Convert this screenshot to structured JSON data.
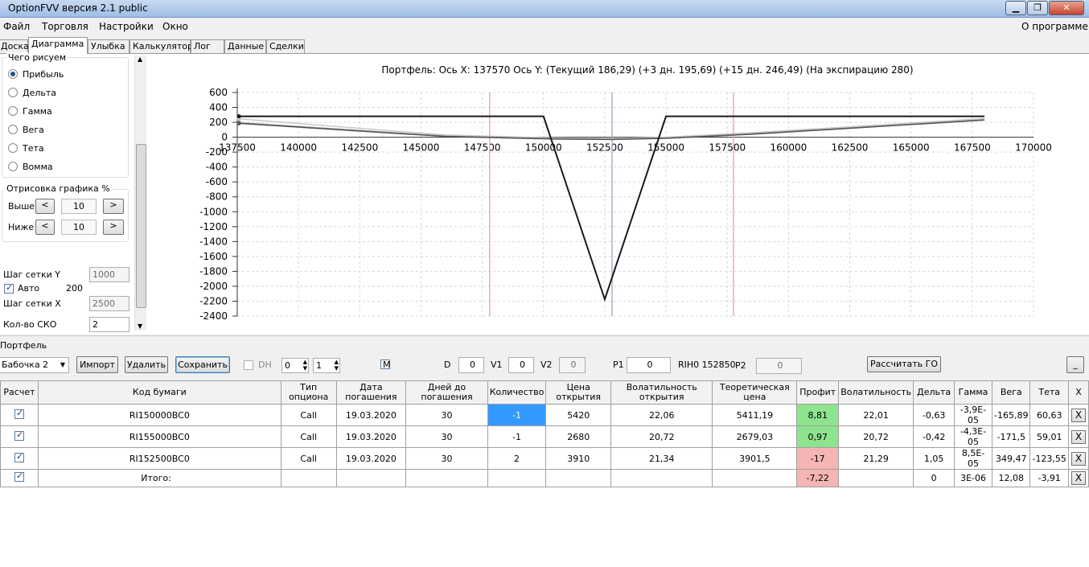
{
  "window": {
    "title": "OptionFVV версия 2.1 public",
    "minimize": "▁",
    "maximize": "❐",
    "close": "✕"
  },
  "menu": {
    "file": "Файл",
    "trading": "Торговля",
    "settings": "Настройки",
    "window": "Окно",
    "about": "О программе"
  },
  "tabs": [
    "Доска",
    "Диаграмма",
    "Улыбка",
    "Калькулятор",
    "Лог",
    "Данные",
    "Сделки"
  ],
  "left_panel": {
    "draw_group_title": "Чего рисуем",
    "radios": [
      "Прибыль",
      "Дельта",
      "Гамма",
      "Вега",
      "Тета",
      "Вомма"
    ],
    "selected_radio": "Прибыль",
    "render_group_title": "Отрисовка графика %",
    "above_label": "Выше",
    "above_value": "10",
    "below_label": "Ниже",
    "below_value": "10",
    "dec": "<",
    "inc": ">",
    "grid_y_label": "Шаг сетки Y",
    "grid_y_value": "1000",
    "auto_label": "Авто",
    "auto_value": "200",
    "grid_x_label": "Шаг сетки X",
    "grid_x_value": "2500",
    "sko_label": "Кол-во СКО",
    "sko_value": "2"
  },
  "chart_data": {
    "type": "line",
    "title": "Портфель: Ось X: 137570 Ось Y:  (Текущий 186,29)  (+3 дн. 195,69)  (+15 дн. 246,49)  (На экспирацию 280)",
    "xlim": [
      137500,
      170000
    ],
    "ylim": [
      -2400,
      600
    ],
    "xticks": [
      137500,
      140000,
      142500,
      145000,
      147500,
      150000,
      152500,
      155000,
      157500,
      160000,
      162500,
      165000,
      167500,
      170000
    ],
    "yticks": [
      600,
      400,
      200,
      0,
      -200,
      -400,
      -600,
      -800,
      -1000,
      -1200,
      -1400,
      -1600,
      -1800,
      -2000,
      -2200,
      -2400
    ],
    "grid": true,
    "vlines": [
      {
        "x": 147800,
        "color": "#f4a6b8"
      },
      {
        "x": 152800,
        "color": "#a8b4c8"
      },
      {
        "x": 157750,
        "color": "#f4a6b8"
      }
    ],
    "series": [
      {
        "color": "#1a1a1a",
        "width": 2,
        "x": [
          137570,
          150000,
          152500,
          155000,
          168000
        ],
        "y": [
          280,
          280,
          -2175,
          280,
          280
        ]
      },
      {
        "color": "#555555",
        "width": 1.5,
        "x": [
          137570,
          146000,
          150500,
          152800,
          155000,
          158500,
          168000
        ],
        "y": [
          186,
          10,
          -25,
          -30,
          -15,
          40,
          230
        ]
      },
      {
        "color": "#9a9a9a",
        "width": 1.5,
        "x": [
          137570,
          146000,
          150500,
          152800,
          155000,
          158500,
          168000
        ],
        "y": [
          196,
          15,
          -20,
          -28,
          -10,
          45,
          235
        ]
      },
      {
        "color": "#c8c8c8",
        "width": 1.5,
        "x": [
          137570,
          146000,
          150500,
          152800,
          155000,
          158500,
          168000
        ],
        "y": [
          246,
          30,
          -10,
          -20,
          0,
          60,
          250
        ]
      }
    ]
  },
  "portfolio_label": "Портфель",
  "toolbar": {
    "portfolio_select": "Бабочка 2",
    "import": "Импорт",
    "delete": "Удалить",
    "save": "Сохранить",
    "dh_label": "DH",
    "dh_spin1": "0",
    "dh_spin2": "1",
    "m_label": "M",
    "d_label": "D",
    "d_value": "0",
    "v1_label": "V1",
    "v1_value": "0",
    "v2_label": "V2",
    "v2_value": "0",
    "p1_label": "P1",
    "p1_value": "0",
    "rih_label": "RIH0 152850",
    "p2_label": "P2",
    "p2_value": "0",
    "calc_go": "Рассчитать ГО",
    "collapse": "_"
  },
  "grid": {
    "headers": [
      "Расчет",
      "Код бумаги",
      "Тип опциона",
      "Дата погашения",
      "Дней до погашения",
      "Количество",
      "Цена открытия",
      "Волатильность открытия",
      "Теоретическая цена",
      "Профит",
      "Волатильность",
      "Дельта",
      "Гамма",
      "Вега",
      "Тета",
      "X"
    ],
    "rows": [
      [
        "RI150000BC0",
        "Call",
        "19.03.2020",
        "30",
        "-1",
        "5420",
        "22,06",
        "5411,19",
        "8,81",
        "22,01",
        "-0,63",
        "-3,9E-05",
        "-165,89",
        "60,63"
      ],
      [
        "RI155000BC0",
        "Call",
        "19.03.2020",
        "30",
        "-1",
        "2680",
        "20,72",
        "2679,03",
        "0,97",
        "20,72",
        "-0,42",
        "-4,3E-05",
        "-171,5",
        "59,01"
      ],
      [
        "RI152500BC0",
        "Call",
        "19.03.2020",
        "30",
        "2",
        "3910",
        "21,34",
        "3901,5",
        "-17",
        "21,29",
        "1,05",
        "8,5E-05",
        "349,47",
        "-123,55"
      ]
    ],
    "total": {
      "label": "Итого:",
      "profit": "-7,22",
      "delta": "0",
      "gamma": "3E-06",
      "vega": "12,08",
      "theta": "-3,91"
    },
    "profit_colors": {
      "positive": "#8ee38e",
      "negative": "#f5b5b5"
    },
    "selected_cell_color": "#3399ff",
    "x_label": "X"
  }
}
